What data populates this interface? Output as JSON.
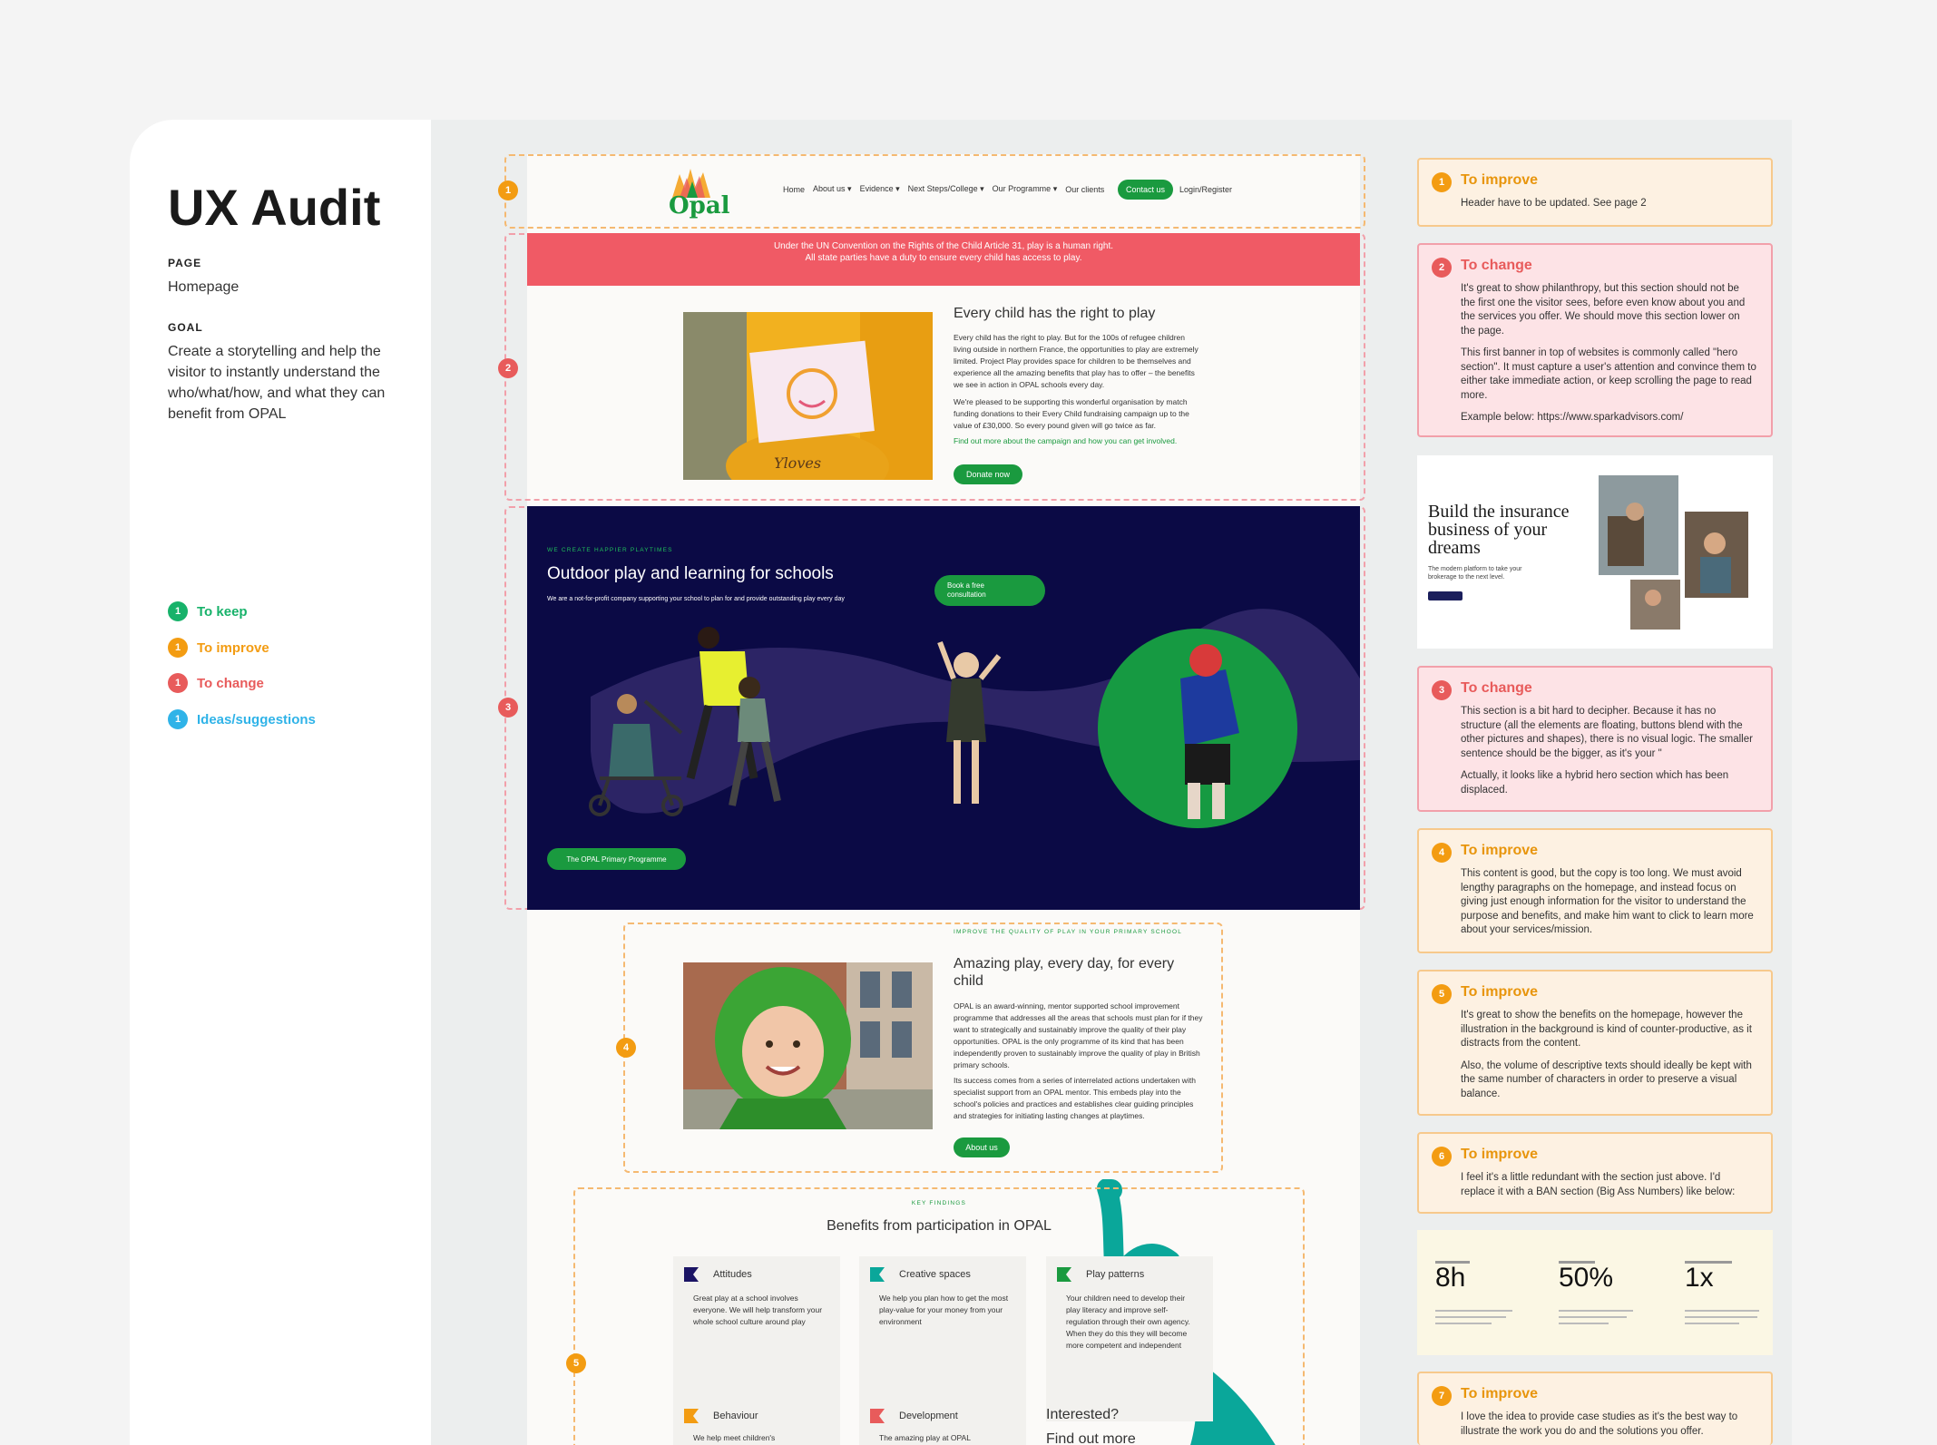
{
  "sidebar": {
    "title": "UX Audit",
    "page_label": "PAGE",
    "page_value": "Homepage",
    "goal_label": "GOAL",
    "goal_value": "Create a storytelling and help the visitor to instantly understand the who/what/how, and what they can benefit from OPAL",
    "legend": [
      {
        "num": "1",
        "label": "To keep",
        "color": "#17b26a"
      },
      {
        "num": "1",
        "label": "To improve",
        "color": "#f39c12"
      },
      {
        "num": "1",
        "label": "To change",
        "color": "#e85b5b"
      },
      {
        "num": "1",
        "label": "Ideas/suggestions",
        "color": "#2fb3e8"
      }
    ]
  },
  "site": {
    "logo": "Opal",
    "nav": [
      "Home",
      "About us ▾",
      "Evidence ▾",
      "Next Steps/College ▾",
      "Our Programme ▾",
      "Our clients"
    ],
    "contact": "Contact us",
    "login": "Login/Register",
    "banner": "Under the UN Convention on the Rights of the Child Article 31, play is a human right. All state parties have a duty to ensure every child has access to play.",
    "s2_title": "Every child has the right to play",
    "s2_p1": "Every child has the right to play. But for the 100s of refugee children living outside in northern France, the opportunities to play are extremely limited. Project Play provides space for children to be themselves and experience all the amazing benefits that play has to offer – the benefits we see in action in OPAL schools every day.",
    "s2_p2": "We're pleased to be supporting this wonderful organisation by match funding donations to their Every Child fundraising campaign up to the value of £30,000. So every pound given will go twice as far.",
    "s2_link": "Find out more about the campaign and how you can get involved.",
    "s2_btn": "Donate now",
    "s3_eyebrow": "WE CREATE HAPPIER PLAYTIMES",
    "s3_title": "Outdoor play and learning for schools",
    "s3_sub": "We are a not-for-profit company supporting your school to plan for and provide outstanding play every day",
    "s3_btn": "Book a free consultation",
    "s3_btn2": "The OPAL Primary Programme",
    "s4_eyebrow": "IMPROVE THE QUALITY OF PLAY IN YOUR PRIMARY SCHOOL",
    "s4_title": "Amazing play, every day, for every child",
    "s4_p1": "OPAL is an award-winning, mentor supported school improvement programme that addresses all the areas that schools must plan for if they want to strategically and sustainably improve the quality of their play opportunities. OPAL is the only programme of its kind that has been independently proven to sustainably improve the quality of play in British primary schools.",
    "s4_p2": "Its success comes from a series of interrelated actions undertaken with specialist support from an OPAL mentor. This embeds play into the school's policies and practices and establishes clear guiding principles and strategies for initiating lasting changes at playtimes.",
    "s4_btn": "About us",
    "s5_eyebrow": "KEY FINDINGS",
    "s5_title": "Benefits from participation in OPAL",
    "benefits": [
      {
        "title": "Attitudes",
        "text": "Great play at a school involves everyone. We will help transform your whole school culture around play",
        "color": "#1b1464"
      },
      {
        "title": "Creative spaces",
        "text": "We help you plan how to get the most play-value for your money from your environment",
        "color": "#0aa79a"
      },
      {
        "title": "Play patterns",
        "text": "Your children need to develop their play literacy and improve self-regulation through their own agency. When they do this they will become more competent and independent",
        "color": "#1a9a3f"
      },
      {
        "title": "Behaviour",
        "text": "We help meet children's",
        "color": "#f39c12"
      },
      {
        "title": "Development",
        "text": "The amazing play at OPAL",
        "color": "#e85b5b"
      }
    ],
    "s5_interested": "Interested?",
    "s5_find": "Find out more"
  },
  "markers": [
    "1",
    "2",
    "3",
    "4",
    "5"
  ],
  "comments": [
    {
      "num": "1",
      "type": "To improve",
      "body": [
        "Header have to be updated. See page 2"
      ]
    },
    {
      "num": "2",
      "type": "To change",
      "body": [
        "It's great to show philanthropy, but this section should not be the first one the visitor sees, before even know about you and the services you offer. We should move this section lower on the page.",
        "This first banner in top of websites is commonly called \"hero section\". It must capture a user's attention and convince them to either take immediate action, or keep scrolling the page to read more.",
        "Example below: https://www.sparkadvisors.com/"
      ]
    },
    {
      "num": "3",
      "type": "To change",
      "body": [
        "This section is a bit hard to decipher. Because it has no structure (all the elements are floating, buttons blend with the other pictures and shapes), there is no visual logic. The smaller sentence should be the bigger, as it's your \"",
        "Actually, it looks like a hybrid hero section which has been displaced."
      ]
    },
    {
      "num": "4",
      "type": "To improve",
      "body": [
        "This content is good, but the copy is too long. We must avoid lengthy paragraphs on the homepage, and instead focus on giving just enough information for the visitor to understand the purpose and benefits, and make him want to click to learn more about your services/mission."
      ]
    },
    {
      "num": "5",
      "type": "To improve",
      "body": [
        "It's great to show the benefits on the homepage, however the illustration in the background is kind of counter-productive, as it distracts from the content.",
        "Also, the volume of descriptive texts should ideally be kept with the same number of characters in order to preserve a visual balance."
      ]
    },
    {
      "num": "6",
      "type": "To improve",
      "body": [
        "I feel it's a little redundant with the section just above. I'd replace it with a BAN section (Big Ass Numbers) like below:"
      ]
    },
    {
      "num": "7",
      "type": "To improve",
      "body": [
        "I love the idea to provide case studies as it's the best way to illustrate the work you do and the solutions you offer."
      ]
    }
  ],
  "example_hero": {
    "title": "Build the insurance business of your dreams",
    "sub": "The modern platform to take your brokerage to the next level."
  },
  "ban": [
    {
      "value": "8h"
    },
    {
      "value": "50%"
    },
    {
      "value": "1x"
    }
  ],
  "colors": {
    "keep": "#17b26a",
    "improve": "#f39c12",
    "change": "#e85b5b",
    "ideas": "#2fb3e8",
    "navy": "#0b0a45",
    "green": "#1a9a3f",
    "banner": "#f05a65"
  }
}
